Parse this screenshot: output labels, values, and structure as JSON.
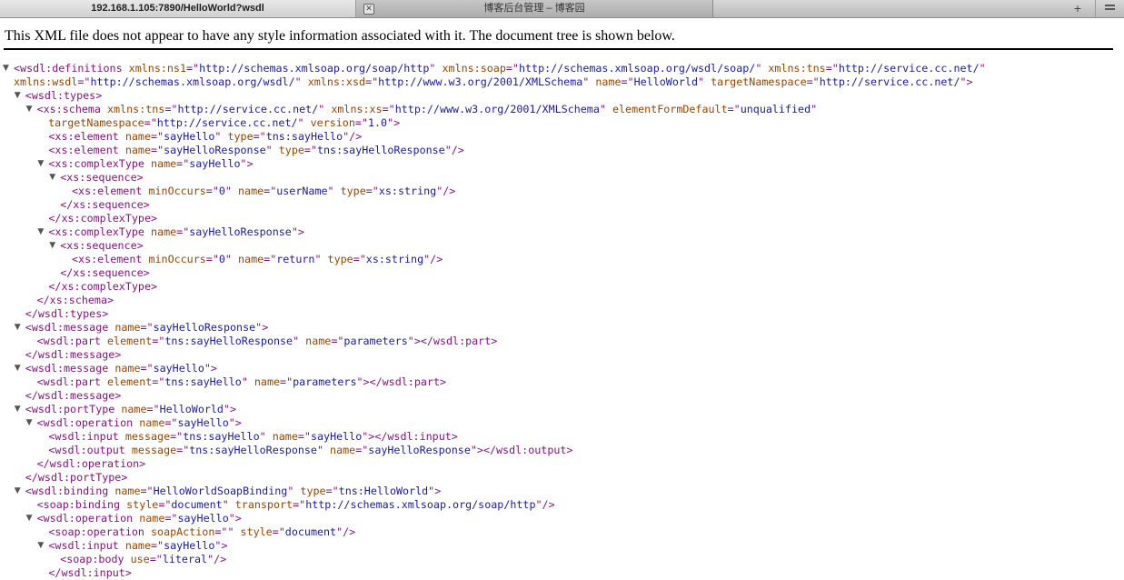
{
  "tabs": [
    {
      "label": "192.168.1.105:7890/HelloWorld?wsdl",
      "active": true
    },
    {
      "label": "博客后台管理 – 博客园",
      "active": false
    }
  ],
  "add_tab_label": "+",
  "info_message": "This XML file does not appear to have any style information associated with it. The document tree is shown below.",
  "xml_lines": [
    {
      "indent": 0,
      "toggle": true,
      "seg": [
        [
          "t",
          "<wsdl:definitions"
        ],
        [
          "t",
          " "
        ],
        [
          "n",
          "xmlns:ns1"
        ],
        [
          "t",
          "=\""
        ],
        [
          "v",
          "http://schemas.xmlsoap.org/soap/http"
        ],
        [
          "t",
          "\" "
        ],
        [
          "n",
          "xmlns:soap"
        ],
        [
          "t",
          "=\""
        ],
        [
          "v",
          "http://schemas.xmlsoap.org/wsdl/soap/"
        ],
        [
          "t",
          "\" "
        ],
        [
          "n",
          "xmlns:tns"
        ],
        [
          "t",
          "=\""
        ],
        [
          "v",
          "http://service.cc.net/"
        ],
        [
          "t",
          "\""
        ]
      ]
    },
    {
      "indent": 0,
      "cont": true,
      "seg": [
        [
          "n",
          "xmlns:wsdl"
        ],
        [
          "t",
          "=\""
        ],
        [
          "v",
          "http://schemas.xmlsoap.org/wsdl/"
        ],
        [
          "t",
          "\" "
        ],
        [
          "n",
          "xmlns:xsd"
        ],
        [
          "t",
          "=\""
        ],
        [
          "v",
          "http://www.w3.org/2001/XMLSchema"
        ],
        [
          "t",
          "\" "
        ],
        [
          "n",
          "name"
        ],
        [
          "t",
          "=\""
        ],
        [
          "v",
          "HelloWorld"
        ],
        [
          "t",
          "\" "
        ],
        [
          "n",
          "targetNamespace"
        ],
        [
          "t",
          "=\""
        ],
        [
          "v",
          "http://service.cc.net/"
        ],
        [
          "t",
          "\">"
        ]
      ]
    },
    {
      "indent": 1,
      "toggle": true,
      "seg": [
        [
          "t",
          "<wsdl:types>"
        ]
      ]
    },
    {
      "indent": 2,
      "toggle": true,
      "seg": [
        [
          "t",
          "<xs:schema"
        ],
        [
          "t",
          " "
        ],
        [
          "n",
          "xmlns:tns"
        ],
        [
          "t",
          "=\""
        ],
        [
          "v",
          "http://service.cc.net/"
        ],
        [
          "t",
          "\" "
        ],
        [
          "n",
          "xmlns:xs"
        ],
        [
          "t",
          "=\""
        ],
        [
          "v",
          "http://www.w3.org/2001/XMLSchema"
        ],
        [
          "t",
          "\" "
        ],
        [
          "n",
          "elementFormDefault"
        ],
        [
          "t",
          "=\""
        ],
        [
          "v",
          "unqualified"
        ],
        [
          "t",
          "\""
        ]
      ]
    },
    {
      "indent": 2,
      "cont": true,
      "seg": [
        [
          "n",
          "targetNamespace"
        ],
        [
          "t",
          "=\""
        ],
        [
          "v",
          "http://service.cc.net/"
        ],
        [
          "t",
          "\" "
        ],
        [
          "n",
          "version"
        ],
        [
          "t",
          "=\""
        ],
        [
          "v",
          "1.0"
        ],
        [
          "t",
          "\">"
        ]
      ]
    },
    {
      "indent": 3,
      "seg": [
        [
          "t",
          "<xs:element"
        ],
        [
          "t",
          " "
        ],
        [
          "n",
          "name"
        ],
        [
          "t",
          "=\""
        ],
        [
          "v",
          "sayHello"
        ],
        [
          "t",
          "\" "
        ],
        [
          "n",
          "type"
        ],
        [
          "t",
          "=\""
        ],
        [
          "v",
          "tns:sayHello"
        ],
        [
          "t",
          "\"/>"
        ]
      ]
    },
    {
      "indent": 3,
      "seg": [
        [
          "t",
          "<xs:element"
        ],
        [
          "t",
          " "
        ],
        [
          "n",
          "name"
        ],
        [
          "t",
          "=\""
        ],
        [
          "v",
          "sayHelloResponse"
        ],
        [
          "t",
          "\" "
        ],
        [
          "n",
          "type"
        ],
        [
          "t",
          "=\""
        ],
        [
          "v",
          "tns:sayHelloResponse"
        ],
        [
          "t",
          "\"/>"
        ]
      ]
    },
    {
      "indent": 3,
      "toggle": true,
      "seg": [
        [
          "t",
          "<xs:complexType"
        ],
        [
          "t",
          " "
        ],
        [
          "n",
          "name"
        ],
        [
          "t",
          "=\""
        ],
        [
          "v",
          "sayHello"
        ],
        [
          "t",
          "\">"
        ]
      ]
    },
    {
      "indent": 4,
      "toggle": true,
      "seg": [
        [
          "t",
          "<xs:sequence>"
        ]
      ]
    },
    {
      "indent": 5,
      "seg": [
        [
          "t",
          "<xs:element"
        ],
        [
          "t",
          " "
        ],
        [
          "n",
          "minOccurs"
        ],
        [
          "t",
          "=\""
        ],
        [
          "v",
          "0"
        ],
        [
          "t",
          "\" "
        ],
        [
          "n",
          "name"
        ],
        [
          "t",
          "=\""
        ],
        [
          "v",
          "userName"
        ],
        [
          "t",
          "\" "
        ],
        [
          "n",
          "type"
        ],
        [
          "t",
          "=\""
        ],
        [
          "v",
          "xs:string"
        ],
        [
          "t",
          "\"/>"
        ]
      ]
    },
    {
      "indent": 4,
      "seg": [
        [
          "t",
          "</xs:sequence>"
        ]
      ]
    },
    {
      "indent": 3,
      "seg": [
        [
          "t",
          "</xs:complexType>"
        ]
      ]
    },
    {
      "indent": 3,
      "toggle": true,
      "seg": [
        [
          "t",
          "<xs:complexType"
        ],
        [
          "t",
          " "
        ],
        [
          "n",
          "name"
        ],
        [
          "t",
          "=\""
        ],
        [
          "v",
          "sayHelloResponse"
        ],
        [
          "t",
          "\">"
        ]
      ]
    },
    {
      "indent": 4,
      "toggle": true,
      "seg": [
        [
          "t",
          "<xs:sequence>"
        ]
      ]
    },
    {
      "indent": 5,
      "seg": [
        [
          "t",
          "<xs:element"
        ],
        [
          "t",
          " "
        ],
        [
          "n",
          "minOccurs"
        ],
        [
          "t",
          "=\""
        ],
        [
          "v",
          "0"
        ],
        [
          "t",
          "\" "
        ],
        [
          "n",
          "name"
        ],
        [
          "t",
          "=\""
        ],
        [
          "v",
          "return"
        ],
        [
          "t",
          "\" "
        ],
        [
          "n",
          "type"
        ],
        [
          "t",
          "=\""
        ],
        [
          "v",
          "xs:string"
        ],
        [
          "t",
          "\"/>"
        ]
      ]
    },
    {
      "indent": 4,
      "seg": [
        [
          "t",
          "</xs:sequence>"
        ]
      ]
    },
    {
      "indent": 3,
      "seg": [
        [
          "t",
          "</xs:complexType>"
        ]
      ]
    },
    {
      "indent": 2,
      "seg": [
        [
          "t",
          "</xs:schema>"
        ]
      ]
    },
    {
      "indent": 1,
      "seg": [
        [
          "t",
          "</wsdl:types>"
        ]
      ]
    },
    {
      "indent": 1,
      "toggle": true,
      "seg": [
        [
          "t",
          "<wsdl:message"
        ],
        [
          "t",
          " "
        ],
        [
          "n",
          "name"
        ],
        [
          "t",
          "=\""
        ],
        [
          "v",
          "sayHelloResponse"
        ],
        [
          "t",
          "\">"
        ]
      ]
    },
    {
      "indent": 2,
      "seg": [
        [
          "t",
          "<wsdl:part"
        ],
        [
          "t",
          " "
        ],
        [
          "n",
          "element"
        ],
        [
          "t",
          "=\""
        ],
        [
          "v",
          "tns:sayHelloResponse"
        ],
        [
          "t",
          "\" "
        ],
        [
          "n",
          "name"
        ],
        [
          "t",
          "=\""
        ],
        [
          "v",
          "parameters"
        ],
        [
          "t",
          "\"></wsdl:part>"
        ]
      ]
    },
    {
      "indent": 1,
      "seg": [
        [
          "t",
          "</wsdl:message>"
        ]
      ]
    },
    {
      "indent": 1,
      "toggle": true,
      "seg": [
        [
          "t",
          "<wsdl:message"
        ],
        [
          "t",
          " "
        ],
        [
          "n",
          "name"
        ],
        [
          "t",
          "=\""
        ],
        [
          "v",
          "sayHello"
        ],
        [
          "t",
          "\">"
        ]
      ]
    },
    {
      "indent": 2,
      "seg": [
        [
          "t",
          "<wsdl:part"
        ],
        [
          "t",
          " "
        ],
        [
          "n",
          "element"
        ],
        [
          "t",
          "=\""
        ],
        [
          "v",
          "tns:sayHello"
        ],
        [
          "t",
          "\" "
        ],
        [
          "n",
          "name"
        ],
        [
          "t",
          "=\""
        ],
        [
          "v",
          "parameters"
        ],
        [
          "t",
          "\"></wsdl:part>"
        ]
      ]
    },
    {
      "indent": 1,
      "seg": [
        [
          "t",
          "</wsdl:message>"
        ]
      ]
    },
    {
      "indent": 1,
      "toggle": true,
      "seg": [
        [
          "t",
          "<wsdl:portType"
        ],
        [
          "t",
          " "
        ],
        [
          "n",
          "name"
        ],
        [
          "t",
          "=\""
        ],
        [
          "v",
          "HelloWorld"
        ],
        [
          "t",
          "\">"
        ]
      ]
    },
    {
      "indent": 2,
      "toggle": true,
      "seg": [
        [
          "t",
          "<wsdl:operation"
        ],
        [
          "t",
          " "
        ],
        [
          "n",
          "name"
        ],
        [
          "t",
          "=\""
        ],
        [
          "v",
          "sayHello"
        ],
        [
          "t",
          "\">"
        ]
      ]
    },
    {
      "indent": 3,
      "seg": [
        [
          "t",
          "<wsdl:input"
        ],
        [
          "t",
          " "
        ],
        [
          "n",
          "message"
        ],
        [
          "t",
          "=\""
        ],
        [
          "v",
          "tns:sayHello"
        ],
        [
          "t",
          "\" "
        ],
        [
          "n",
          "name"
        ],
        [
          "t",
          "=\""
        ],
        [
          "v",
          "sayHello"
        ],
        [
          "t",
          "\"></wsdl:input>"
        ]
      ]
    },
    {
      "indent": 3,
      "seg": [
        [
          "t",
          "<wsdl:output"
        ],
        [
          "t",
          " "
        ],
        [
          "n",
          "message"
        ],
        [
          "t",
          "=\""
        ],
        [
          "v",
          "tns:sayHelloResponse"
        ],
        [
          "t",
          "\" "
        ],
        [
          "n",
          "name"
        ],
        [
          "t",
          "=\""
        ],
        [
          "v",
          "sayHelloResponse"
        ],
        [
          "t",
          "\"></wsdl:output>"
        ]
      ]
    },
    {
      "indent": 2,
      "seg": [
        [
          "t",
          "</wsdl:operation>"
        ]
      ]
    },
    {
      "indent": 1,
      "seg": [
        [
          "t",
          "</wsdl:portType>"
        ]
      ]
    },
    {
      "indent": 1,
      "toggle": true,
      "seg": [
        [
          "t",
          "<wsdl:binding"
        ],
        [
          "t",
          " "
        ],
        [
          "n",
          "name"
        ],
        [
          "t",
          "=\""
        ],
        [
          "v",
          "HelloWorldSoapBinding"
        ],
        [
          "t",
          "\" "
        ],
        [
          "n",
          "type"
        ],
        [
          "t",
          "=\""
        ],
        [
          "v",
          "tns:HelloWorld"
        ],
        [
          "t",
          "\">"
        ]
      ]
    },
    {
      "indent": 2,
      "seg": [
        [
          "t",
          "<soap:binding"
        ],
        [
          "t",
          " "
        ],
        [
          "n",
          "style"
        ],
        [
          "t",
          "=\""
        ],
        [
          "v",
          "document"
        ],
        [
          "t",
          "\" "
        ],
        [
          "n",
          "transport"
        ],
        [
          "t",
          "=\""
        ],
        [
          "v",
          "http://schemas.xmlsoap.org/soap/http"
        ],
        [
          "t",
          "\"/>"
        ]
      ]
    },
    {
      "indent": 2,
      "toggle": true,
      "seg": [
        [
          "t",
          "<wsdl:operation"
        ],
        [
          "t",
          " "
        ],
        [
          "n",
          "name"
        ],
        [
          "t",
          "=\""
        ],
        [
          "v",
          "sayHello"
        ],
        [
          "t",
          "\">"
        ]
      ]
    },
    {
      "indent": 3,
      "seg": [
        [
          "t",
          "<soap:operation"
        ],
        [
          "t",
          " "
        ],
        [
          "n",
          "soapAction"
        ],
        [
          "t",
          "=\""
        ],
        [
          "v",
          ""
        ],
        [
          "t",
          "\" "
        ],
        [
          "n",
          "style"
        ],
        [
          "t",
          "=\""
        ],
        [
          "v",
          "document"
        ],
        [
          "t",
          "\"/>"
        ]
      ]
    },
    {
      "indent": 3,
      "toggle": true,
      "seg": [
        [
          "t",
          "<wsdl:input"
        ],
        [
          "t",
          " "
        ],
        [
          "n",
          "name"
        ],
        [
          "t",
          "=\""
        ],
        [
          "v",
          "sayHello"
        ],
        [
          "t",
          "\">"
        ]
      ]
    },
    {
      "indent": 4,
      "seg": [
        [
          "t",
          "<soap:body"
        ],
        [
          "t",
          " "
        ],
        [
          "n",
          "use"
        ],
        [
          "t",
          "=\""
        ],
        [
          "v",
          "literal"
        ],
        [
          "t",
          "\"/>"
        ]
      ]
    },
    {
      "indent": 3,
      "seg": [
        [
          "t",
          "</wsdl:input>"
        ]
      ]
    }
  ]
}
